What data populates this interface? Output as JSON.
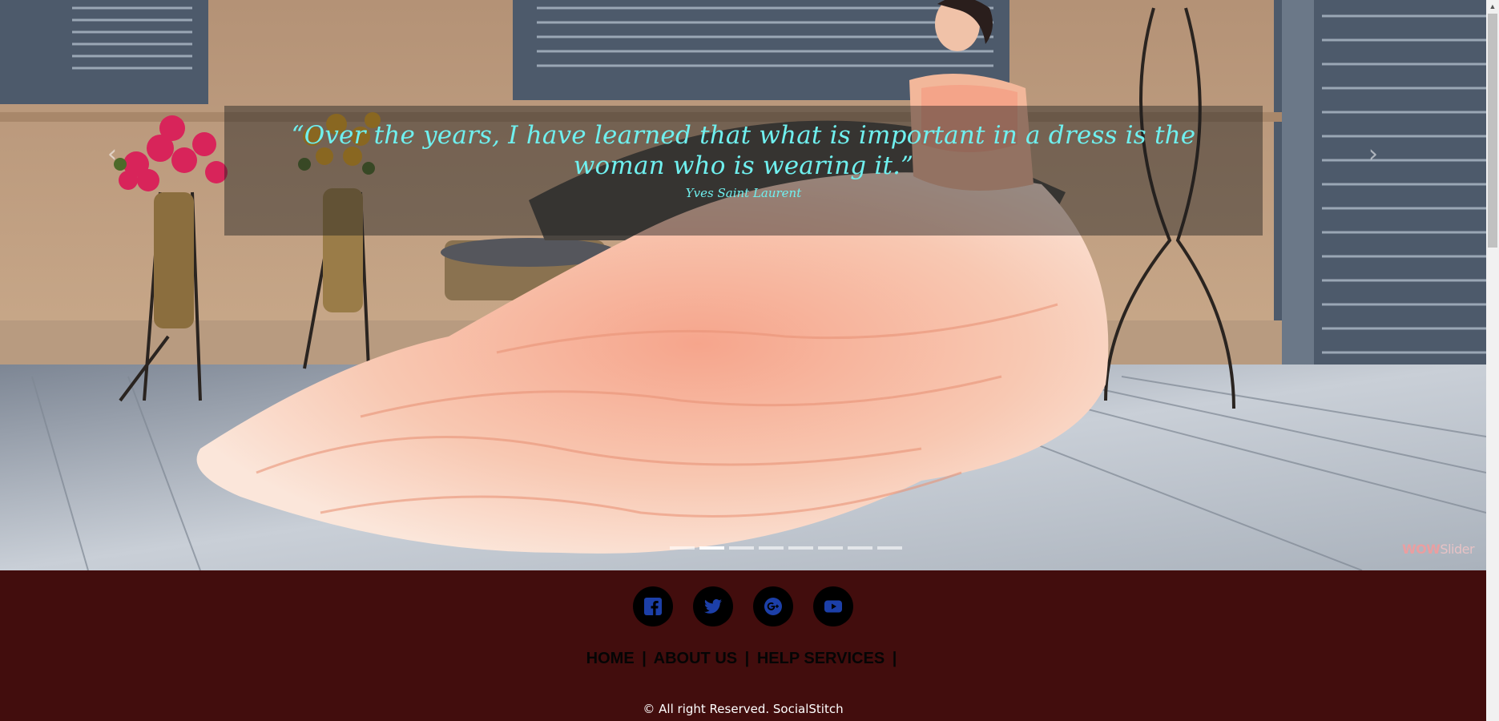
{
  "slider": {
    "quote": "“Over the years, I have learned that what is important in a dress is the woman who is wearing it.”",
    "author": "Yves Saint Laurent",
    "prev_icon": "chevron-left-icon",
    "next_icon": "chevron-right-icon",
    "prev_glyph": "‹",
    "next_glyph": "›",
    "bullet_count": 8,
    "active_bullet": 1,
    "brand": {
      "part1": "WOW",
      "part2": "Slider"
    }
  },
  "footer": {
    "social": [
      {
        "name": "facebook-icon"
      },
      {
        "name": "twitter-icon"
      },
      {
        "name": "google-plus-icon"
      },
      {
        "name": "youtube-icon"
      }
    ],
    "nav": [
      {
        "label": "HOME"
      },
      {
        "label": "ABOUT US"
      },
      {
        "label": "HELP SERVICES"
      }
    ],
    "separator": "|",
    "copyright": "© All right Reserved.  SocialStitch"
  },
  "colors": {
    "footer_bg": "#420d0d",
    "quote_text": "#6ff0ef",
    "social_bg": "#000000",
    "social_icon": "#1c3fa8"
  }
}
